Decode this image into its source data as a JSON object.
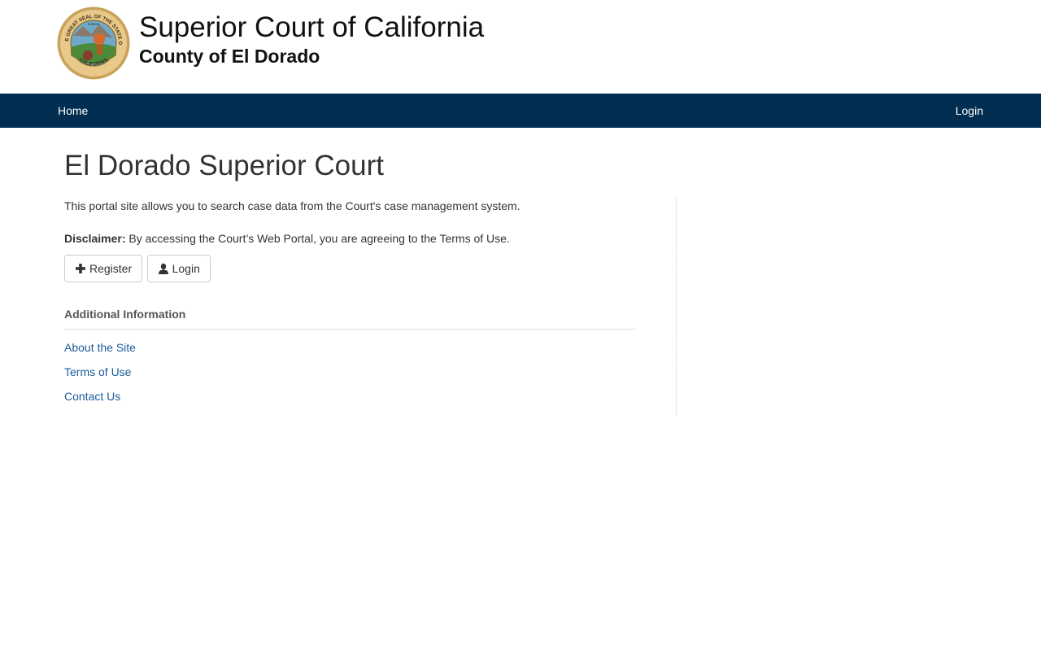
{
  "header": {
    "title": "Superior Court of California",
    "subtitle": "County of El Dorado",
    "seal": {
      "text_top": "THE GREAT SEAL OF THE STATE OF",
      "text_bottom": "CALIFORNIA",
      "motto": "EUREKA"
    }
  },
  "nav": {
    "home_label": "Home",
    "login_label": "Login"
  },
  "main": {
    "page_title": "El Dorado Superior Court",
    "intro": "This portal site allows you to search case data from the Court's case management system.",
    "disclaimer_label": "Disclaimer:",
    "disclaimer_text": " By accessing the Court’s Web Portal, you are agreeing to the Terms of Use.",
    "buttons": {
      "register_label": "Register",
      "login_label": "Login"
    },
    "additional": {
      "heading": "Additional Information",
      "links": [
        {
          "label": "About the Site"
        },
        {
          "label": "Terms of Use"
        },
        {
          "label": "Contact Us"
        }
      ]
    }
  },
  "colors": {
    "navbar": "#002d50",
    "link": "#1a5b9b",
    "text": "#333333"
  },
  "icons": {
    "register": "plus-icon",
    "login": "user-icon"
  }
}
